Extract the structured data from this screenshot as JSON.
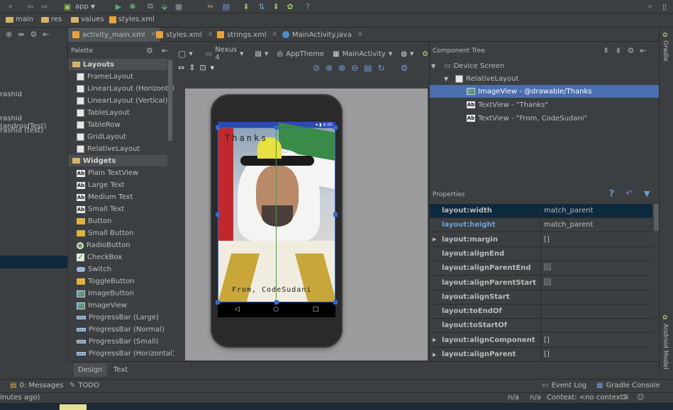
{
  "toolbar": {
    "run_config": "app",
    "icons": [
      "find-icon",
      "back-icon",
      "forward-icon",
      "android-icon",
      "run-icon",
      "debug-icon",
      "attach-icon",
      "stop-icon",
      "structure-icon",
      "sdk-icon",
      "avd-icon",
      "sync-icon",
      "android-monitor-icon",
      "help-icon",
      "search-icon"
    ]
  },
  "breadcrumb": [
    "main",
    "res",
    "values",
    "styles.xml"
  ],
  "file_tabs": [
    {
      "label": "activity_main.xml",
      "type": "xml",
      "active": true
    },
    {
      "label": "styles.xml",
      "type": "xml",
      "active": false
    },
    {
      "label": "strings.xml",
      "type": "xml",
      "active": false
    },
    {
      "label": "MainActivity.java",
      "type": "java",
      "active": false
    }
  ],
  "left_panel": {
    "items": [
      "rashid",
      "rashid (androidTest)",
      "rashid (test)"
    ]
  },
  "palette": {
    "title": "Palette",
    "layouts_label": "Layouts",
    "layouts": [
      "FrameLayout",
      "LinearLayout (Horizontal)",
      "LinearLayout (Vertical)",
      "TableLayout",
      "TableRow",
      "GridLayout",
      "RelativeLayout"
    ],
    "widgets_label": "Widgets",
    "widgets": [
      {
        "label": "Plain TextView",
        "icon": "ab"
      },
      {
        "label": "Large Text",
        "icon": "ab"
      },
      {
        "label": "Medium Text",
        "icon": "ab"
      },
      {
        "label": "Small Text",
        "icon": "ab"
      },
      {
        "label": "Button",
        "icon": "button"
      },
      {
        "label": "Small Button",
        "icon": "button"
      },
      {
        "label": "RadioButton",
        "icon": "radio"
      },
      {
        "label": "CheckBox",
        "icon": "check"
      },
      {
        "label": "Switch",
        "icon": "switch"
      },
      {
        "label": "ToggleButton",
        "icon": "button"
      },
      {
        "label": "ImageButton",
        "icon": "image"
      },
      {
        "label": "ImageView",
        "icon": "image"
      },
      {
        "label": "ProgressBar (Large)",
        "icon": "progress"
      },
      {
        "label": "ProgressBar (Normal)",
        "icon": "progress"
      },
      {
        "label": "ProgressBar (Small)",
        "icon": "progress"
      },
      {
        "label": "ProgressBar (Horizontal)",
        "icon": "progress"
      }
    ]
  },
  "design_toolbar": {
    "device": "Nexus 4",
    "theme": "AppTheme",
    "activity": "MainActivity",
    "api": "23"
  },
  "preview": {
    "status_time": "6:00",
    "text_top": "Thanks",
    "text_bottom": "From, CodeSudani"
  },
  "component_tree": {
    "title": "Component Tree",
    "items": [
      {
        "label": "Device Screen",
        "level": 0
      },
      {
        "label": "RelativeLayout",
        "level": 1
      },
      {
        "label": "ImageView - @drawable/Thanks",
        "level": 2,
        "selected": true
      },
      {
        "label": "TextView - \"Thanks\"",
        "level": 2
      },
      {
        "label": "TextView - \"From, CodeSudani\"",
        "level": 2
      }
    ]
  },
  "properties": {
    "title": "Properties",
    "rows": [
      {
        "name": "layout:width",
        "value": "match_parent",
        "type": "text",
        "expand": false,
        "highlight": true
      },
      {
        "name": "layout:height",
        "value": "match_parent",
        "type": "text",
        "expand": false,
        "highlight": false,
        "link": true
      },
      {
        "name": "layout:margin",
        "value": "[]",
        "type": "text",
        "expand": true
      },
      {
        "name": "layout:alignEnd",
        "value": "",
        "type": "text",
        "expand": false
      },
      {
        "name": "layout:alignParentEnd",
        "value": "",
        "type": "check",
        "expand": false
      },
      {
        "name": "layout:alignParentStart",
        "value": "",
        "type": "check",
        "expand": false
      },
      {
        "name": "layout:alignStart",
        "value": "",
        "type": "text",
        "expand": false
      },
      {
        "name": "layout:toEndOf",
        "value": "",
        "type": "text",
        "expand": false
      },
      {
        "name": "layout:toStartOf",
        "value": "",
        "type": "text",
        "expand": false
      },
      {
        "name": "layout:alignComponent",
        "value": "[]",
        "type": "text",
        "expand": true
      },
      {
        "name": "layout:alignParent",
        "value": "[]",
        "type": "text",
        "expand": true
      }
    ]
  },
  "right_strip": {
    "top": "Gradle",
    "bottom": "Android Model"
  },
  "bottom_tabs": [
    {
      "label": "Design",
      "active": true
    },
    {
      "label": "Text",
      "active": false
    }
  ],
  "tool_windows": {
    "messages": "0: Messages",
    "todo": "TODO",
    "event_log": "Event Log",
    "gradle_console": "Gradle Console"
  },
  "status": {
    "left": "inutes ago)",
    "na1": "n/a",
    "na2": "n/a",
    "context": "Context: <no context>"
  },
  "colors": {
    "accent": "#4b6eaf",
    "selection": "#4b6eaf",
    "bg": "#3c3f41"
  }
}
